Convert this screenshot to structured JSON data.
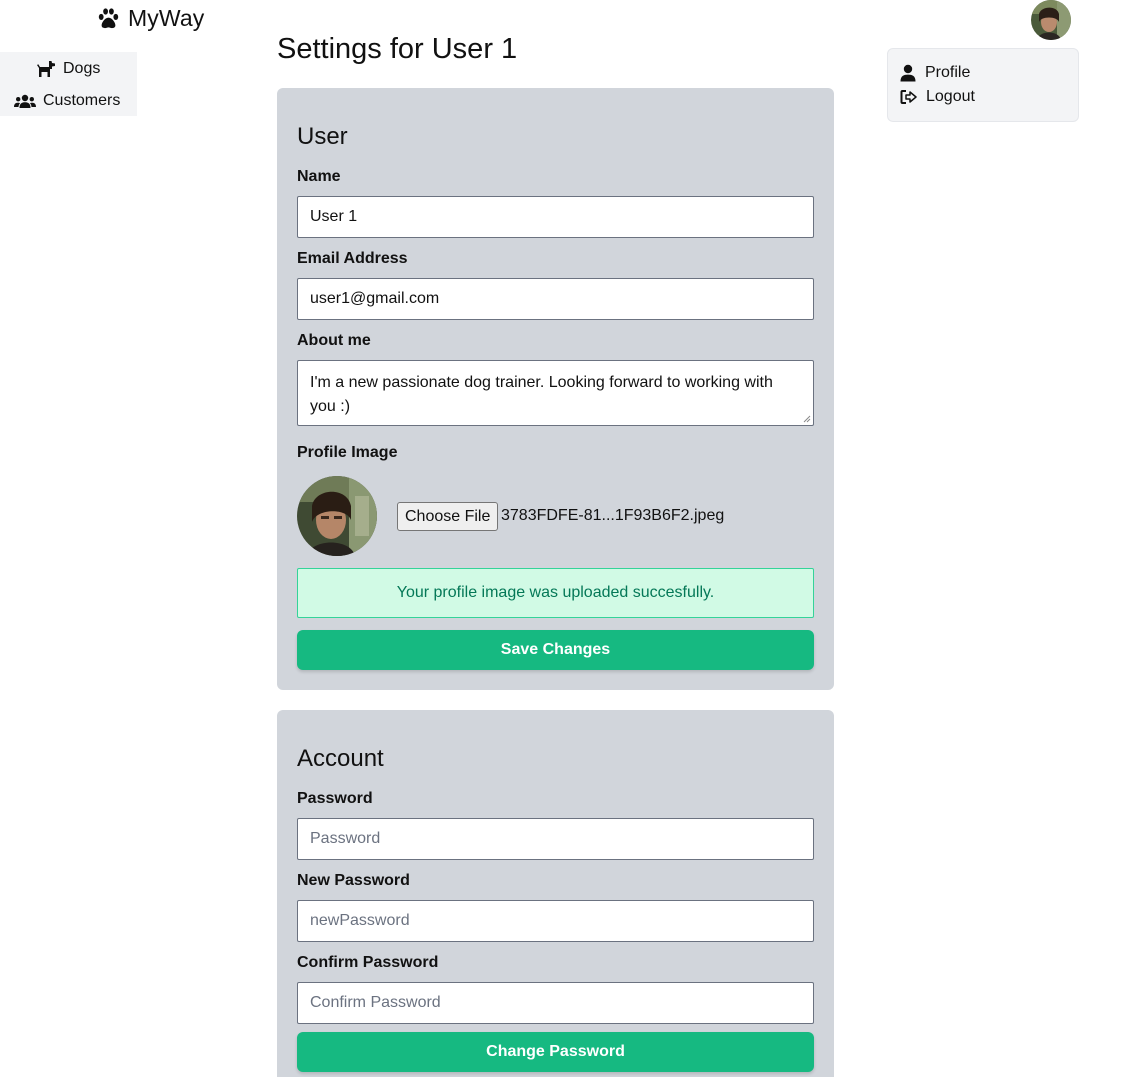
{
  "brand": {
    "name": "MyWay",
    "icon": "paw-icon"
  },
  "sidebar": {
    "items": [
      {
        "label": "Dogs",
        "icon": "dog-icon"
      },
      {
        "label": "Customers",
        "icon": "users-icon"
      }
    ]
  },
  "user_menu": {
    "items": [
      {
        "label": "Profile",
        "icon": "user-icon"
      },
      {
        "label": "Logout",
        "icon": "logout-icon"
      }
    ]
  },
  "page": {
    "title": "Settings for User 1"
  },
  "user_section": {
    "heading": "User",
    "name_label": "Name",
    "name_value": "User 1",
    "email_label": "Email Address",
    "email_value": "user1@gmail.com",
    "about_label": "About me",
    "about_value": "I'm a new passionate dog trainer. Looking forward to working with you :)",
    "image_label": "Profile Image",
    "choose_file_label": "Choose File",
    "file_name": "3783FDFE-81...1F93B6F2.jpeg",
    "success_message": "Your profile image was uploaded succesfully.",
    "save_button": "Save Changes"
  },
  "account_section": {
    "heading": "Account",
    "password_label": "Password",
    "password_placeholder": "Password",
    "new_password_label": "New Password",
    "new_password_placeholder": "newPassword",
    "confirm_password_label": "Confirm Password",
    "confirm_password_placeholder": "Confirm Password",
    "change_button": "Change Password"
  },
  "colors": {
    "accent": "#16b981",
    "card_bg": "#d1d5db",
    "menu_bg": "#f3f4f6",
    "success_bg": "#d1fae5",
    "success_text": "#047857"
  }
}
